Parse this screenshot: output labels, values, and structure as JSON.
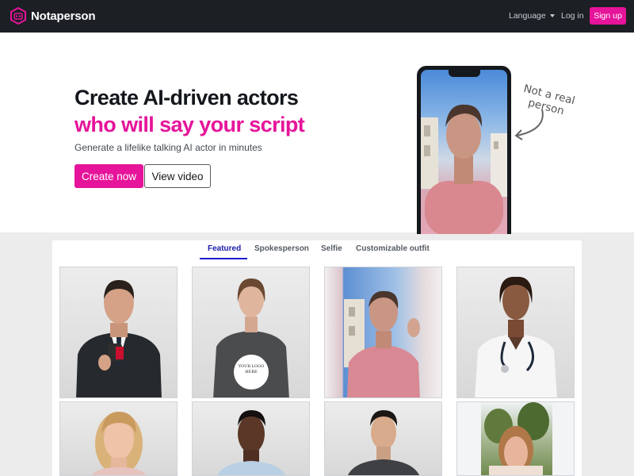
{
  "navbar": {
    "brand": "Notaperson",
    "language": "Language",
    "login": "Log in",
    "signup": "Sign up",
    "accent": "#e6149a",
    "background": "#1c1f24"
  },
  "hero": {
    "title_line1": "Create AI-driven actors",
    "title_line2": "who will say your script",
    "subtitle": "Generate a lifelike talking AI actor in minutes",
    "create_button": "Create now",
    "video_button": "View video",
    "note": "Not a real person"
  },
  "gallery": {
    "tabs": [
      {
        "label": "Featured",
        "active": true
      },
      {
        "label": "Spokesperson",
        "active": false
      },
      {
        "label": "Selfie",
        "active": false
      },
      {
        "label": "Customizable outfit",
        "active": false
      }
    ],
    "actors": [
      {
        "name": "man-with-microphone",
        "shirt_text": ""
      },
      {
        "name": "woman-in-tshirt",
        "shirt_text": "YOUR LOGO HERE"
      },
      {
        "name": "man-selfie",
        "shirt_text": ""
      },
      {
        "name": "doctor-woman",
        "shirt_text": ""
      },
      {
        "name": "young-girl",
        "shirt_text": ""
      },
      {
        "name": "man-in-shirt",
        "shirt_text": ""
      },
      {
        "name": "man-in-tshirt",
        "shirt_text": ""
      },
      {
        "name": "woman-outdoors",
        "shirt_text": ""
      }
    ]
  }
}
